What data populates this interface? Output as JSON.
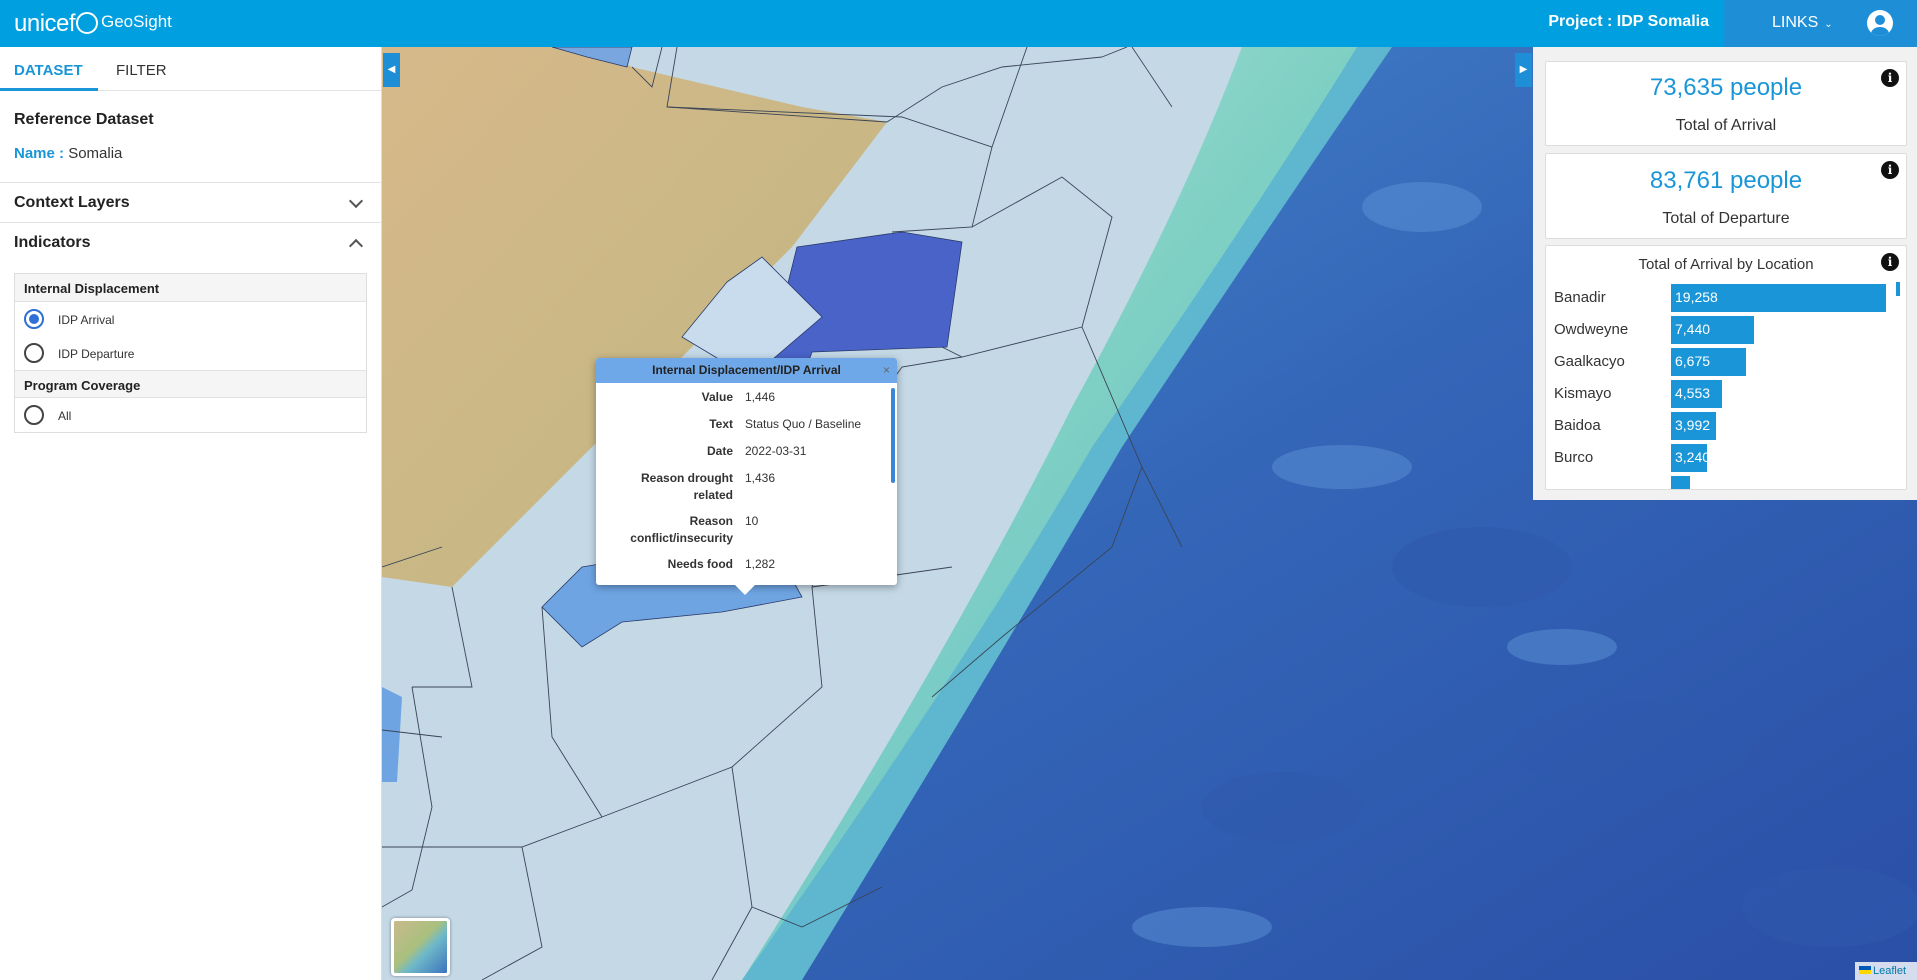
{
  "header": {
    "logo": "unicef",
    "app_name": "GeoSight",
    "project": "Project : IDP Somalia",
    "links": "LINKS",
    "colors": {
      "bar": "#009fe0",
      "accent": "#1e8fd6"
    }
  },
  "sidebar": {
    "tabs": [
      "DATASET",
      "FILTER"
    ],
    "reference_title": "Reference Dataset",
    "name_label": "Name :",
    "name_value": "Somalia",
    "context_layers": "Context Layers",
    "indicators": "Indicators",
    "groups": [
      {
        "title": "Internal Displacement",
        "options": [
          {
            "label": "IDP Arrival",
            "checked": true
          },
          {
            "label": "IDP Departure",
            "checked": false
          }
        ]
      },
      {
        "title": "Program Coverage",
        "options": [
          {
            "label": "All",
            "checked": false
          }
        ]
      }
    ]
  },
  "map": {
    "left_toggle": "◀",
    "right_toggle": "▶",
    "attribution": "Leaflet",
    "popup": {
      "title": "Internal Displacement/IDP Arrival",
      "close": "×",
      "rows": [
        {
          "label": "Value",
          "value": "1,446"
        },
        {
          "label": "Text",
          "value": "Status Quo / Baseline"
        },
        {
          "label": "Date",
          "value": "2022-03-31"
        },
        {
          "label": "Reason drought related",
          "value": "1,436"
        },
        {
          "label": "Reason conflict/insecurity",
          "value": "10"
        },
        {
          "label": "Needs food",
          "value": "1,282"
        }
      ]
    }
  },
  "widgets": {
    "arrival": {
      "value": "73,635 people",
      "label": "Total of Arrival"
    },
    "departure": {
      "value": "83,761 people",
      "label": "Total of Departure"
    },
    "by_location": {
      "title": "Total of Arrival by Location",
      "max": 19258,
      "items": [
        {
          "name": "Banadir",
          "value": 19258,
          "label": "19,258"
        },
        {
          "name": "Owdweyne",
          "value": 7440,
          "label": "7,440"
        },
        {
          "name": "Gaalkacyo",
          "value": 6675,
          "label": "6,675"
        },
        {
          "name": "Kismayo",
          "value": 4553,
          "label": "4,553"
        },
        {
          "name": "Baidoa",
          "value": 3992,
          "label": "3,992"
        },
        {
          "name": "Burco",
          "value": 3240,
          "label": "3,240"
        }
      ]
    }
  }
}
